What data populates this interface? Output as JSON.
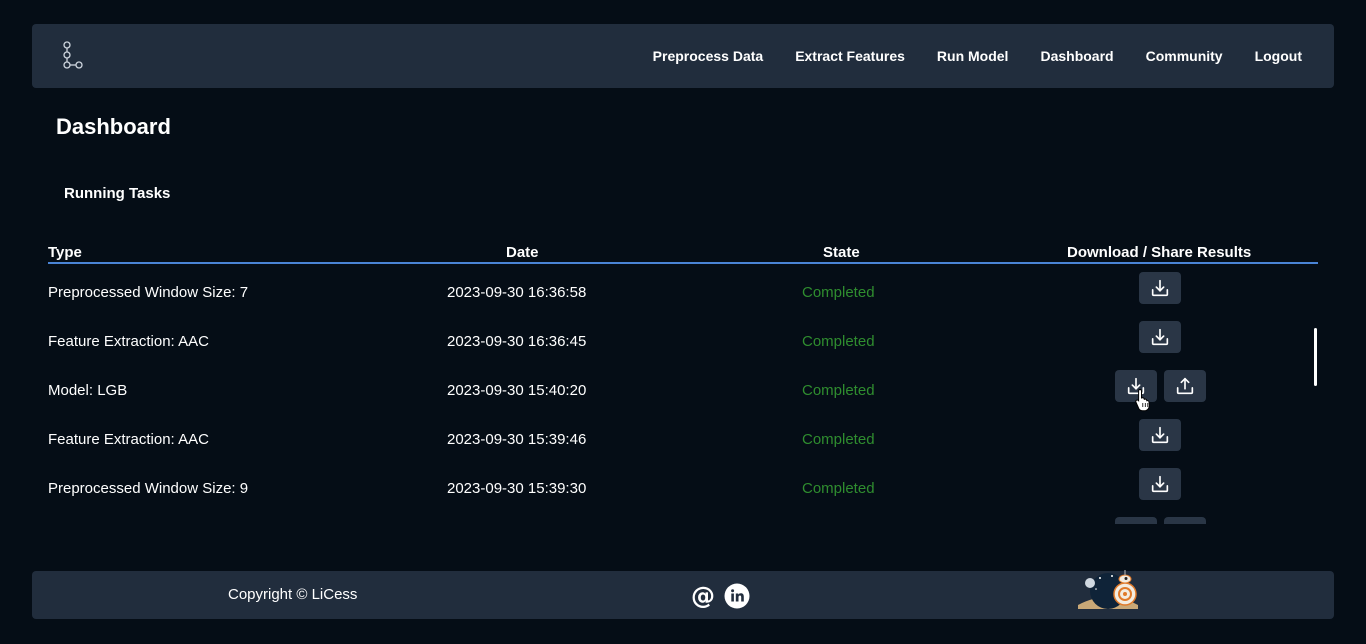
{
  "navbar": {
    "logo_icon": "graph-nodes-icon",
    "links": [
      {
        "label": "Preprocess Data"
      },
      {
        "label": "Extract Features"
      },
      {
        "label": "Run Model"
      },
      {
        "label": "Dashboard"
      },
      {
        "label": "Community"
      },
      {
        "label": "Logout"
      }
    ]
  },
  "page": {
    "title": "Dashboard",
    "section_title": "Running Tasks"
  },
  "table": {
    "headers": {
      "type": "Type",
      "date": "Date",
      "state": "State",
      "download": "Download / Share Results"
    },
    "rows": [
      {
        "type": "Preprocessed Window Size: 7",
        "date": "2023-09-30 16:36:58",
        "state": "Completed",
        "actions": [
          "download-icon"
        ]
      },
      {
        "type": "Feature Extraction: AAC",
        "date": "2023-09-30 16:36:45",
        "state": "Completed",
        "actions": [
          "download-icon"
        ]
      },
      {
        "type": "Model: LGB",
        "date": "2023-09-30 15:40:20",
        "state": "Completed",
        "actions": [
          "download-icon",
          "share-icon"
        ]
      },
      {
        "type": "Feature Extraction: AAC",
        "date": "2023-09-30 15:39:46",
        "state": "Completed",
        "actions": [
          "download-icon"
        ]
      },
      {
        "type": "Preprocessed Window Size: 9",
        "date": "2023-09-30 15:39:30",
        "state": "Completed",
        "actions": [
          "download-icon"
        ]
      },
      {
        "type": "",
        "date": "",
        "state": "",
        "actions": [
          "download-icon",
          "share-icon"
        ]
      }
    ]
  },
  "footer": {
    "copyright": "Copyright © LiCess",
    "social": [
      "email-at-icon",
      "linkedin-icon"
    ],
    "mascot": "robot-mascot-icon"
  },
  "colors": {
    "background": "#050d16",
    "panel": "#212d3d",
    "accent_line": "#4a84d6",
    "state_completed": "#2f8d2f",
    "button_bg": "#2a3646"
  }
}
